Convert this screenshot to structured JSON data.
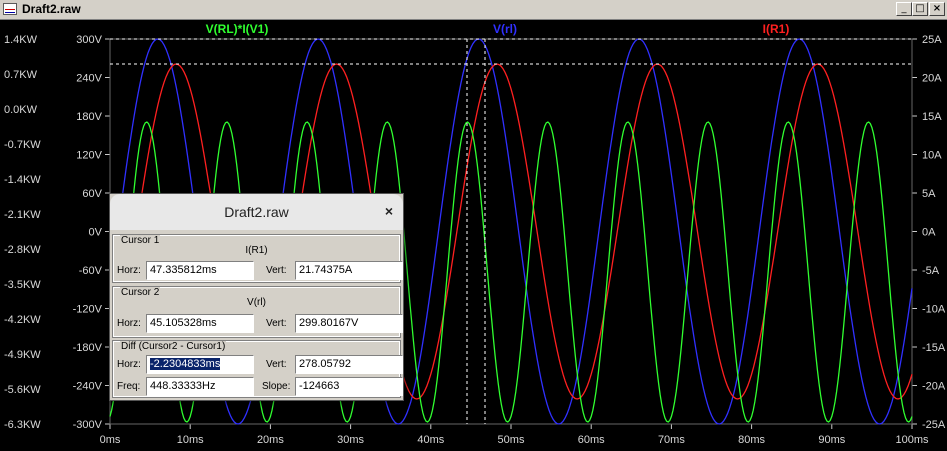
{
  "window": {
    "title": "Draft2.raw",
    "min_label": "_",
    "max_label": "□",
    "close_label": "×"
  },
  "plot": {
    "trace_labels": [
      {
        "text": "V(RL)*I(V1)",
        "color": "#30ff30"
      },
      {
        "text": "V(rl)",
        "color": "#3030ff"
      },
      {
        "text": "I(R1)",
        "color": "#ff2020"
      }
    ],
    "left_power_ticks": [
      "1.4KW",
      "0.7KW",
      "0.0KW",
      "-0.7KW",
      "-1.4KW",
      "-2.1KW",
      "-2.8KW",
      "-3.5KW",
      "-4.2KW",
      "-4.9KW",
      "-5.6KW",
      "-6.3KW"
    ],
    "left_voltage_ticks": [
      "300V",
      "240V",
      "180V",
      "120V",
      "60V",
      "0V",
      "-60V",
      "-120V",
      "-180V",
      "-240V",
      "-300V"
    ],
    "right_current_ticks": [
      "25A",
      "20A",
      "15A",
      "10A",
      "5A",
      "0A",
      "-5A",
      "-10A",
      "-15A",
      "-20A",
      "-25A"
    ],
    "x_ticks": [
      "0ms",
      "10ms",
      "20ms",
      "30ms",
      "40ms",
      "50ms",
      "60ms",
      "70ms",
      "80ms",
      "90ms",
      "100ms"
    ],
    "colors": {
      "power": "#30ff30",
      "voltage": "#3030ff",
      "current": "#ff2020",
      "grid": "#ffffff",
      "axis_text": "#d8d8d8"
    }
  },
  "cursor_dialog": {
    "title": "Draft2.raw",
    "close": "×",
    "cursor1": {
      "label": "Cursor 1",
      "trace": "I(R1)",
      "horz_label": "Horz:",
      "horz": "47.335812ms",
      "vert_label": "Vert:",
      "vert": "21.74375A"
    },
    "cursor2": {
      "label": "Cursor 2",
      "trace": "V(rl)",
      "horz_label": "Horz:",
      "horz": "45.105328ms",
      "vert_label": "Vert:",
      "vert": "299.80167V"
    },
    "diff": {
      "label": "Diff (Cursor2 - Cursor1)",
      "horz_label": "Horz:",
      "horz": "-2.2304833ms",
      "vert_label": "Vert:",
      "vert": "278.05792",
      "freq_label": "Freq:",
      "freq": "448.33333Hz",
      "slope_label": "Slope:",
      "slope": "-124663"
    }
  }
}
